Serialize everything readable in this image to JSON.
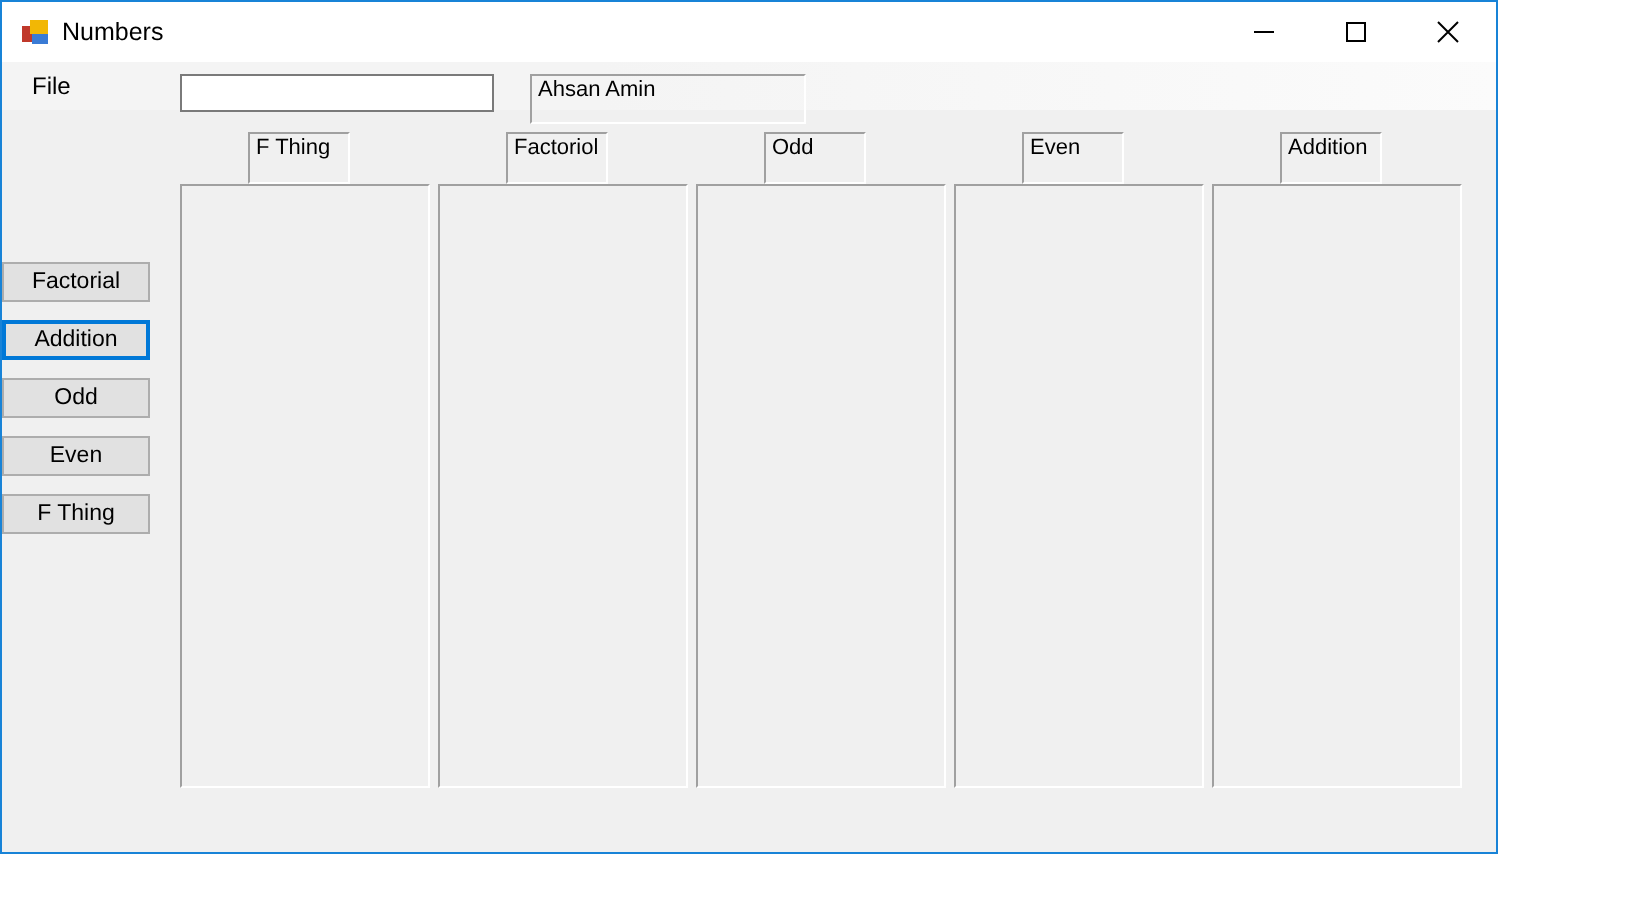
{
  "window": {
    "title": "Numbers"
  },
  "menu": [
    "File"
  ],
  "name_label": "Ahsan Amin",
  "buttons": [
    {
      "label": "Factorial",
      "focused": false
    },
    {
      "label": "Addition",
      "focused": true
    },
    {
      "label": "Odd",
      "focused": false
    },
    {
      "label": "Even",
      "focused": false
    },
    {
      "label": "F Thing",
      "focused": false
    }
  ],
  "panels": [
    {
      "header": "F Thing"
    },
    {
      "header": "Factoriol"
    },
    {
      "header": "Odd"
    },
    {
      "header": "Even"
    },
    {
      "header": "Addition"
    }
  ]
}
